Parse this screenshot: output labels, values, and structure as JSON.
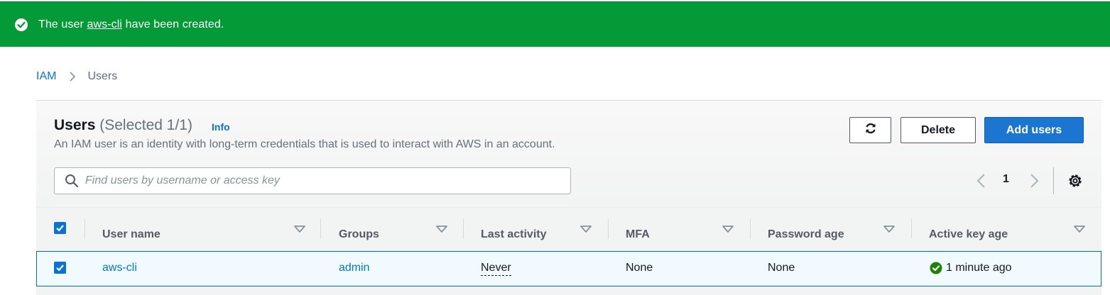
{
  "flash": {
    "message_prefix": "The user ",
    "user_link": "aws-cli",
    "message_suffix": " have been created.",
    "icon": "check-circle-icon",
    "color": "#039a37"
  },
  "breadcrumb": {
    "root": "IAM",
    "current": "Users"
  },
  "header": {
    "title": "Users",
    "count": "(Selected 1/1)",
    "info": "Info",
    "description": "An IAM user is an identity with long-term credentials that is used to interact with AWS in an account."
  },
  "actions": {
    "refresh_icon": "refresh-icon",
    "delete_label": "Delete",
    "add_label": "Add users",
    "primary_color": "#1b76d2"
  },
  "search": {
    "placeholder": "Find users by username or access key",
    "value": ""
  },
  "pagination": {
    "page": "1"
  },
  "table": {
    "columns": [
      "User name",
      "Groups",
      "Last activity",
      "MFA",
      "Password age",
      "Active key age"
    ],
    "rows": [
      {
        "selected": true,
        "user_name": "aws-cli",
        "groups": "admin",
        "last_activity": "Never",
        "mfa": "None",
        "password_age": "None",
        "active_key_age": "1 minute ago"
      }
    ]
  }
}
